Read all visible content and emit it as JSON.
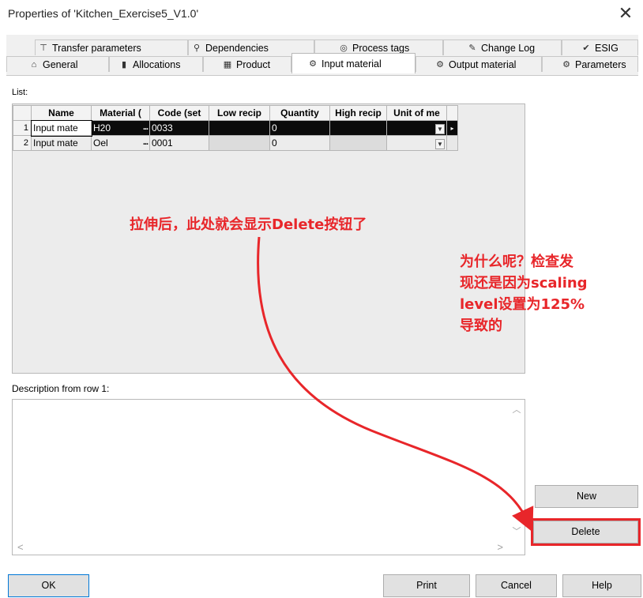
{
  "window": {
    "title": "Properties of 'Kitchen_Exercise5_V1.0'",
    "close_glyph": "✕"
  },
  "tabs": {
    "row_back": [
      {
        "label": "Transfer parameters",
        "icon": "transfer-icon",
        "glyph": "⊤"
      },
      {
        "label": "Dependencies",
        "icon": "dependencies-icon",
        "glyph": "⚲"
      },
      {
        "label": "Process tags",
        "icon": "process-tags-icon",
        "glyph": "◎"
      },
      {
        "label": "Change Log",
        "icon": "pencil-icon",
        "glyph": "✎"
      },
      {
        "label": "ESIG",
        "icon": "esig-icon",
        "glyph": "✔"
      }
    ],
    "row_front": [
      {
        "label": "General",
        "icon": "general-icon",
        "glyph": "⌂"
      },
      {
        "label": "Allocations",
        "icon": "allocations-icon",
        "glyph": "▮"
      },
      {
        "label": "Product",
        "icon": "product-icon",
        "glyph": "▦"
      },
      {
        "label": "Input material",
        "icon": "input-material-icon",
        "glyph": "⚙",
        "active": true
      },
      {
        "label": "Output material",
        "icon": "output-material-icon",
        "glyph": "⚙"
      },
      {
        "label": "Parameters",
        "icon": "parameters-icon",
        "glyph": "⚙"
      }
    ]
  },
  "list": {
    "label": "List:",
    "columns": [
      "Name",
      "Material (",
      "Code (set",
      "Low recip",
      "Quantity",
      "High recip",
      "Unit of me"
    ],
    "rows": [
      {
        "num": "1",
        "name": "Input mate",
        "material": "H20",
        "code": "0033",
        "low": "",
        "quantity": "0",
        "high": "",
        "unit": ""
      },
      {
        "num": "2",
        "name": "Input mate",
        "material": "Oel",
        "code": "0001",
        "low": "",
        "quantity": "0",
        "high": "",
        "unit": ""
      }
    ],
    "ellipsis": "..."
  },
  "description": {
    "label": "Description from row 1:",
    "value": ""
  },
  "buttons": {
    "new": "New",
    "delete": "Delete",
    "ok": "OK",
    "print": "Print",
    "cancel": "Cancel",
    "help": "Help"
  },
  "annotations": {
    "note1": "拉伸后，此处就会显示Delete按钮了",
    "note2_lines": [
      "为什么呢？检查发",
      "现还是因为scaling",
      "level设置为125%",
      "导致的"
    ],
    "color": "#e8262a"
  }
}
